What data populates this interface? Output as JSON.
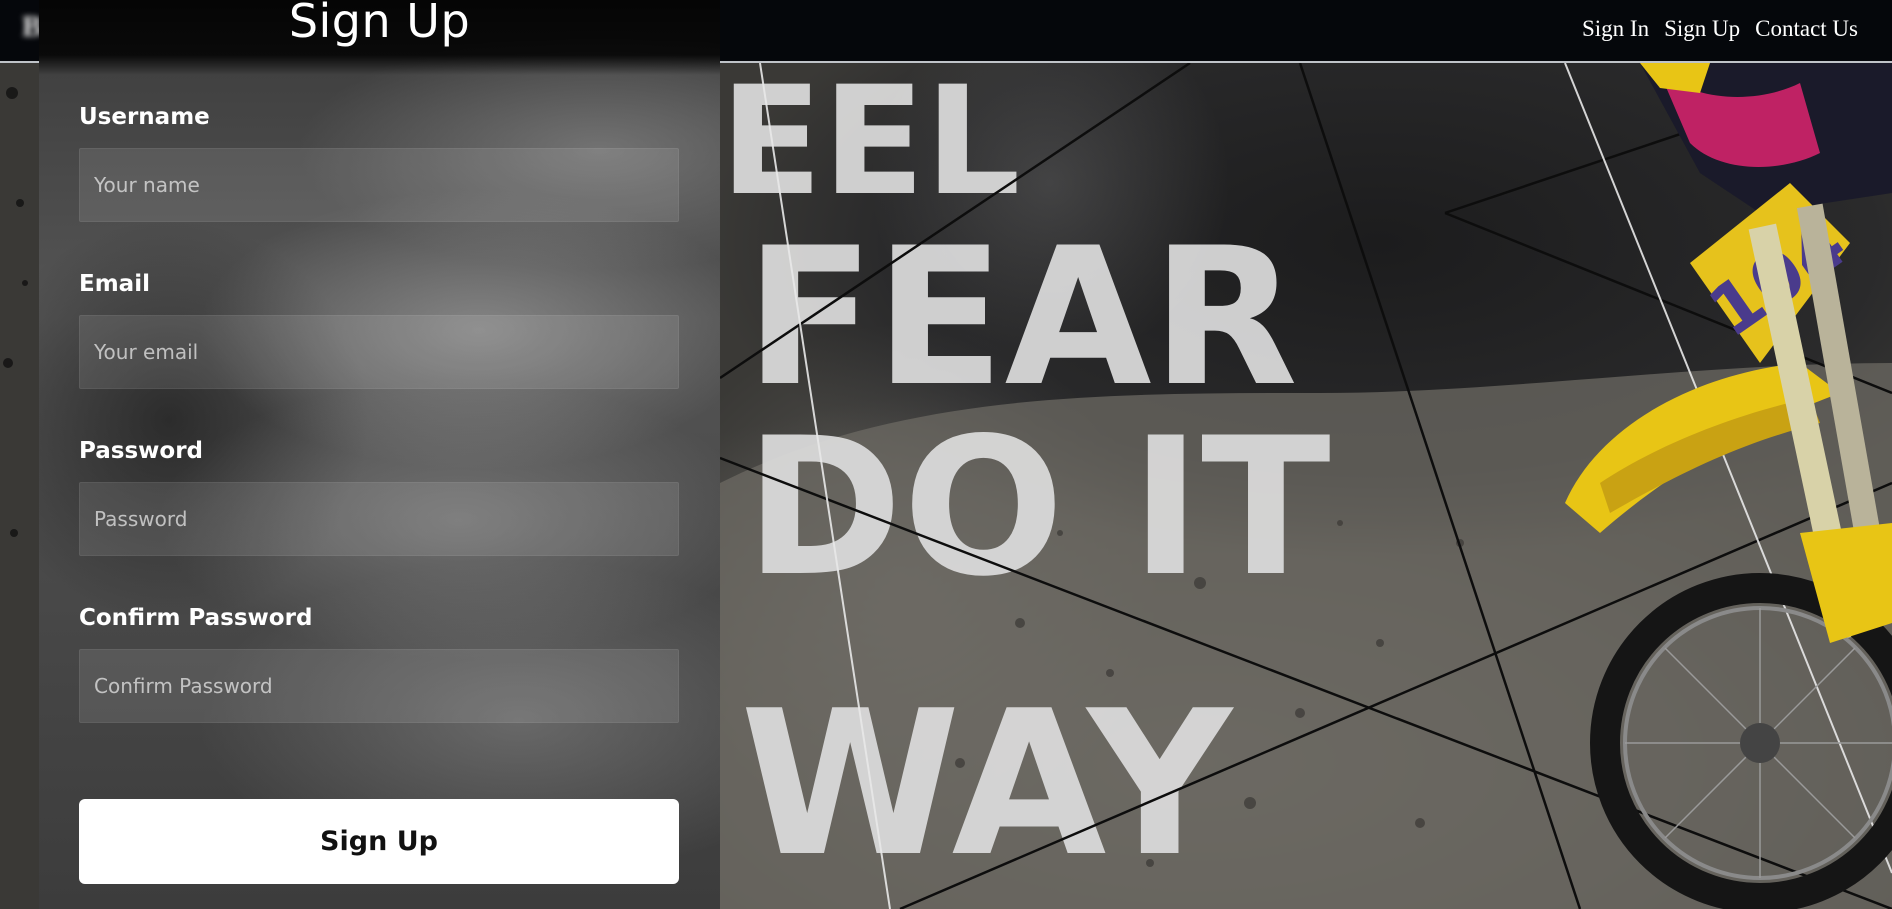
{
  "brand": {
    "name": "B"
  },
  "nav": {
    "items": [
      {
        "label": "Sign In"
      },
      {
        "label": "Sign Up"
      },
      {
        "label": "Contact Us"
      }
    ]
  },
  "signup": {
    "title": "Sign Up",
    "fields": [
      {
        "label": "Username",
        "placeholder": "Your name"
      },
      {
        "label": "Email",
        "placeholder": "Your email"
      },
      {
        "label": "Password",
        "placeholder": "Password"
      },
      {
        "label": "Confirm Password",
        "placeholder": "Confirm Password"
      }
    ],
    "submit_label": "Sign Up"
  },
  "background": {
    "poster_lines": [
      "EEL",
      "FEAR",
      "DO IT",
      "WAY"
    ],
    "colors": {
      "topbar": "#05070b",
      "dirt": "#6b6862",
      "bike_yellow": "#e8c515",
      "bike_pink": "#d2246a"
    }
  }
}
